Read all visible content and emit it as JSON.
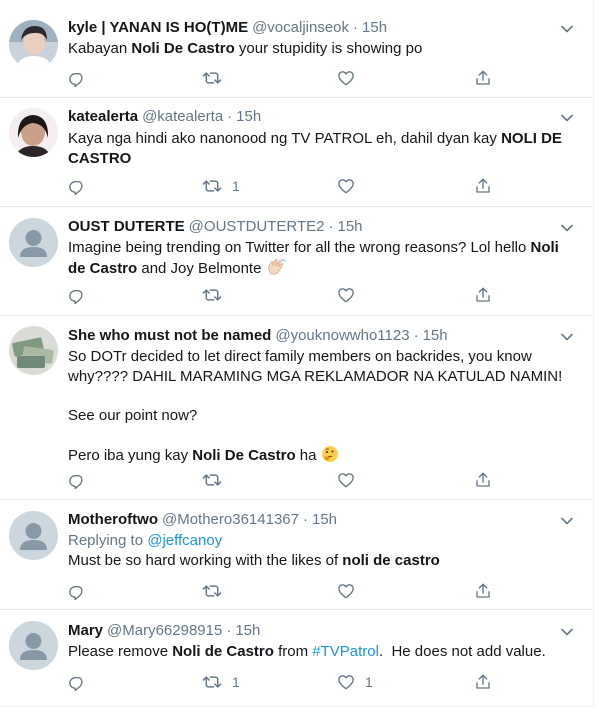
{
  "colors": {
    "name": "#14171a",
    "muted": "#657786",
    "link": "#1b95e0",
    "divider": "#e6ecf0"
  },
  "tweets": [
    {
      "name": "kyle | YANAN IS HO(T)ME",
      "handle": "@vocaljinseok",
      "dot": "·",
      "time": "15h",
      "avatar_icon": "photo-avatar",
      "text": {
        "t1": "Kabayan ",
        "b1": "Noli De Castro",
        "t2": " your stupidity is showing po"
      },
      "retweets": "",
      "likes": ""
    },
    {
      "name": "katealerta",
      "handle": "@katealerta",
      "dot": "·",
      "time": "15h",
      "avatar_icon": "photo-avatar",
      "text": {
        "t1": "Kaya nga hindi ako nanonood ng TV PATROL eh, dahil dyan kay ",
        "b1": "NOLI DE CASTRO"
      },
      "retweets": "1",
      "likes": ""
    },
    {
      "name": "OUST DUTERTE",
      "handle": "@OUSTDUTERTE2",
      "dot": "·",
      "time": "15h",
      "avatar_icon": "default-avatar",
      "text": {
        "t1": "Imagine being trending on Twitter for all the wrong reasons? Lol hello ",
        "b1": "Noli de Castro",
        "t2": " and Joy Belmonte ",
        "emoji": "waving-hand-emoji"
      },
      "retweets": "",
      "likes": ""
    },
    {
      "name": "She who must not be named",
      "handle": "@youknowwho1123",
      "dot": "·",
      "time": "15h",
      "avatar_icon": "photo-avatar",
      "text": {
        "p1": "So DOTr decided to let direct family members on backrides, you know why???? DAHIL MARAMING MGA REKLAMADOR NA KATULAD NAMIN!",
        "p2": "See our point now?",
        "p3a": "Pero iba yung kay ",
        "p3b": "Noli De Castro",
        "p3c": " ha ",
        "emoji": "thinking-face-emoji"
      },
      "retweets": "",
      "likes": ""
    },
    {
      "name": "Motheroftwo",
      "handle": "@Mothero36141367",
      "dot": "·",
      "time": "15h",
      "avatar_icon": "default-avatar",
      "replying_label": "Replying to ",
      "replying_to": "@jeffcanoy",
      "text": {
        "t1": "Must be so hard working with the likes of ",
        "b1": "noli de castro"
      },
      "retweets": "",
      "likes": ""
    },
    {
      "name": "Mary",
      "handle": "@Mary66298915",
      "dot": "·",
      "time": "15h",
      "avatar_icon": "default-avatar",
      "text": {
        "t1": "Please remove ",
        "b1": "Noli de Castro",
        "t2": " from ",
        "link": "#TVPatrol",
        "t3": ".  He does not add value."
      },
      "retweets": "1",
      "likes": "1"
    }
  ]
}
